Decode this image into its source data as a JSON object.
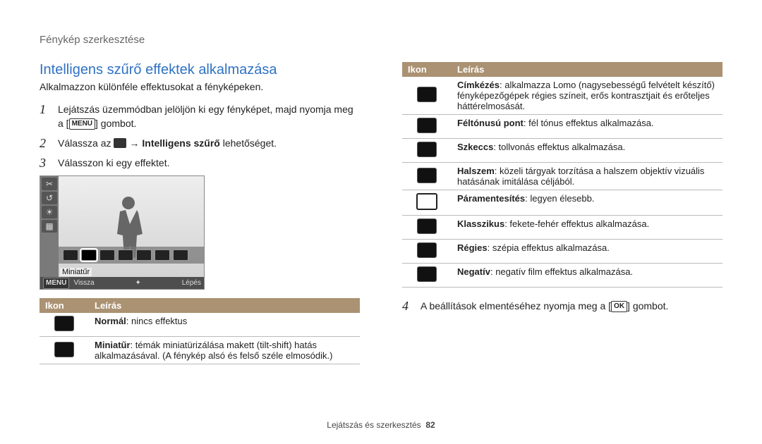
{
  "header_title": "Fénykép szerkesztése",
  "section_title": "Intelligens szűrő effektek alkalmazása",
  "lead": "Alkalmazzon különféle effektusokat a fényképeken.",
  "steps": {
    "s1_a": "Lejátszás üzemmódban jelöljön ki egy fényképet, majd nyomja meg a [",
    "s1_b": "] gombot.",
    "s1_btn": "MENU",
    "s2_a": "Válassza az ",
    "s2_arrow": "→",
    "s2_bold": "Intelligens szűrő",
    "s2_c": " lehetőséget.",
    "s3": "Válasszon ki egy effektet."
  },
  "preview": {
    "effect_label": "Miniatűr",
    "back_label": "Vissza",
    "menu_label": "MENU",
    "step_label": "Lépés"
  },
  "table_headers": {
    "icon": "Ikon",
    "desc": "Leírás"
  },
  "left_rows": [
    {
      "bold": "Normál",
      "rest": ": nincs effektus"
    },
    {
      "bold": "Miniatűr",
      "rest": ": témák miniatürizálása makett (tilt-shift) hatás alkalmazásával. (A fénykép alsó és felső széle elmosódik.)"
    }
  ],
  "right_rows": [
    {
      "bold": "Címkézés",
      "rest": ": alkalmazza Lomo (nagysebességű felvételt készítő) fényképezőgépek régies színeit, erős kontrasztjait és erőteljes háttérelmosását."
    },
    {
      "bold": "Féltónusú pont",
      "rest": ": fél tónus effektus alkalmazása."
    },
    {
      "bold": "Szkeccs",
      "rest": ": tollvonás effektus alkalmazása."
    },
    {
      "bold": "Halszem",
      "rest": ": közeli tárgyak torzítása a halszem objektív vizuális hatásának imitálása céljából."
    },
    {
      "bold": "Páramentesítés",
      "rest": ": legyen élesebb."
    },
    {
      "bold": "Klasszikus",
      "rest": ": fekete-fehér effektus alkalmazása."
    },
    {
      "bold": "Régies",
      "rest": ": szépia effektus alkalmazása."
    },
    {
      "bold": "Negatív",
      "rest": ": negatív film effektus alkalmazása."
    }
  ],
  "step4_a": "A beállítások elmentéséhez nyomja meg a [",
  "step4_btn": "OK",
  "step4_b": "] gombot.",
  "footer": {
    "label": "Lejátszás és szerkesztés",
    "page": "82"
  }
}
